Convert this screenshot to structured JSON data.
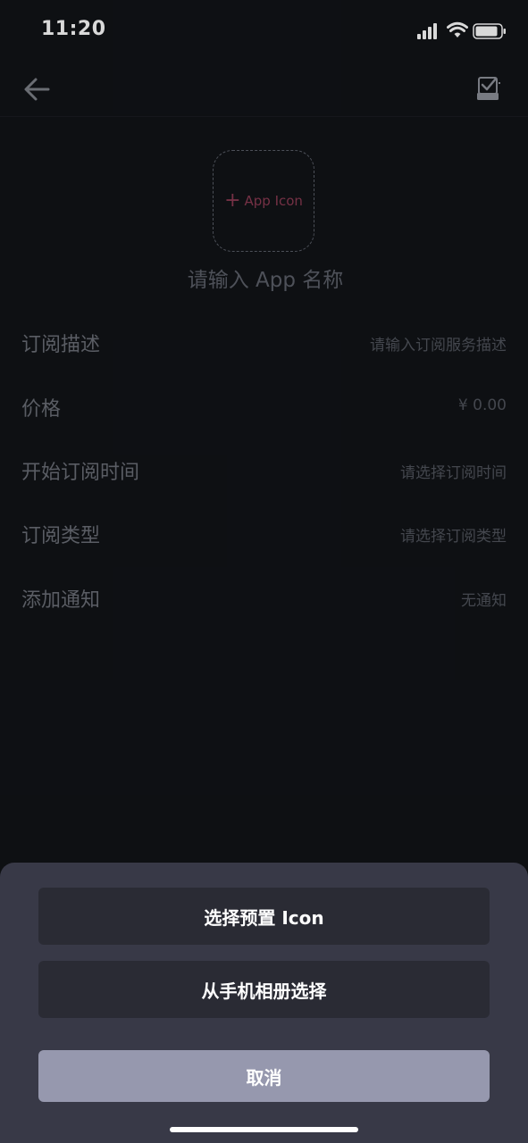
{
  "status_bar": {
    "time": "11:20"
  },
  "nav": {
    "back_icon": "arrow-left-icon",
    "save_icon": "checkbox-save-icon"
  },
  "app_icon_picker": {
    "plus": "+",
    "label": "App Icon"
  },
  "app_name": {
    "placeholder": "请输入 App 名称",
    "value": ""
  },
  "form": {
    "rows": [
      {
        "label": "订阅描述",
        "value": "请输入订阅服务描述"
      },
      {
        "label": "价格",
        "value": "¥ 0.00"
      },
      {
        "label": "开始订阅时间",
        "value": "请选择订阅时间"
      },
      {
        "label": "订阅类型",
        "value": "请选择订阅类型"
      },
      {
        "label": "添加通知",
        "value": "无通知"
      }
    ]
  },
  "action_sheet": {
    "preset_icon_label": "选择预置 Icon",
    "album_label": "从手机相册选择",
    "cancel_label": "取消"
  },
  "colors": {
    "background": "#111317",
    "sheet_background": "#383947",
    "sheet_button": "#2a2b34",
    "cancel_button": "#9698ae",
    "accent": "#8a3a52"
  }
}
